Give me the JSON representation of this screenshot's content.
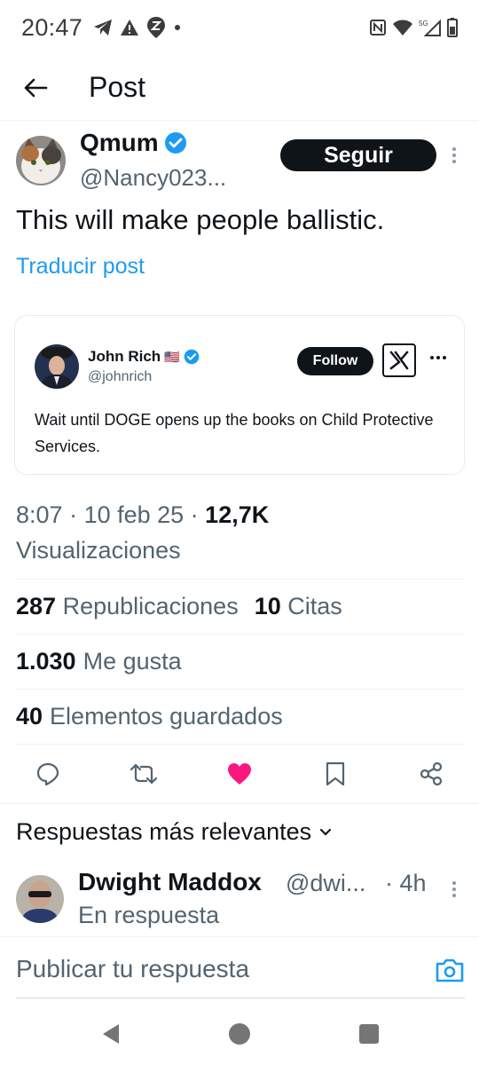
{
  "status_bar": {
    "time": "20:47",
    "icons_left": [
      "telegram-icon",
      "warning-icon",
      "location-z-icon",
      "dot-icon"
    ],
    "icons_right": [
      "nfc-icon",
      "wifi-icon",
      "signal-5g-icon",
      "battery-icon"
    ]
  },
  "header": {
    "title": "Post"
  },
  "author": {
    "name": "Qmum",
    "handle": "@Nancy023...",
    "verified": true,
    "follow_label": "Seguir"
  },
  "tweet": {
    "text": "This will make people ballistic.",
    "translate_label": "Traducir post"
  },
  "embedded_post": {
    "name": "John Rich",
    "flag": "🇺🇸",
    "handle": "@johnrich",
    "follow_label": "Follow",
    "text": "Wait until DOGE opens up the books on Child Protective Services."
  },
  "meta": {
    "time": "8:07",
    "date": "10 feb 25",
    "views_count": "12,7K",
    "views_label": "Visualizaciones"
  },
  "stats": {
    "reposts_count": "287",
    "reposts_label": "Republicaciones",
    "quotes_count": "10",
    "quotes_label": "Citas",
    "likes_count": "1.030",
    "likes_label": "Me gusta",
    "bookmarks_count": "40",
    "bookmarks_label": "Elementos guardados"
  },
  "actions": [
    "reply-icon",
    "repost-icon",
    "like-icon",
    "bookmark-icon",
    "share-icon"
  ],
  "colors": {
    "accent": "#1d9bf0",
    "like": "#f91880",
    "text": "#0f1419",
    "muted": "#536471"
  },
  "replies": {
    "heading": "Respuestas más relevantes",
    "items": [
      {
        "name": "Dwight Maddox",
        "handle": "@dwi...",
        "time": "· 4h",
        "subtext": "En respuesta"
      }
    ]
  },
  "composer": {
    "placeholder": "Publicar tu respuesta"
  },
  "nav": [
    "back-triangle-icon",
    "home-circle-icon",
    "recents-square-icon"
  ]
}
